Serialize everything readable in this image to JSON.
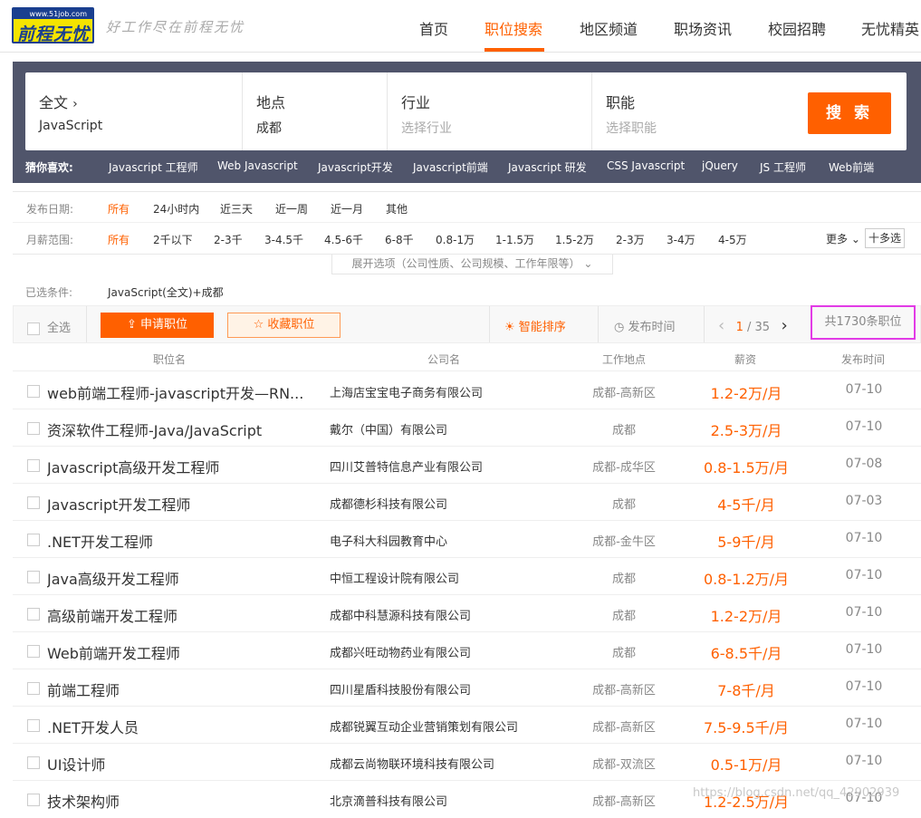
{
  "header": {
    "logo_url": "www.51job.com",
    "logo_name": "前程无忧",
    "slogan": "好工作尽在前程无忧",
    "nav": [
      {
        "label": "首页"
      },
      {
        "label": "职位搜索"
      },
      {
        "label": "地区频道"
      },
      {
        "label": "职场资讯"
      },
      {
        "label": "校园招聘"
      },
      {
        "label": "无忧精英"
      }
    ]
  },
  "search": {
    "fulltext_label": "全文",
    "fulltext_value": "JavaScript",
    "location_label": "地点",
    "location_value": "成都",
    "industry_label": "行业",
    "industry_placeholder": "选择行业",
    "function_label": "职能",
    "function_placeholder": "选择职能",
    "button": "搜 索",
    "guess_label": "猜你喜欢:",
    "guess": [
      "Javascript 工程师",
      "Web Javascript",
      "Javascript开发",
      "Javascript前端",
      "Javascript 研发",
      "CSS Javascript",
      "jQuery",
      "JS 工程师",
      "Web前端"
    ]
  },
  "filters": {
    "date_label": "发布日期:",
    "date_opts": [
      "所有",
      "24小时内",
      "近三天",
      "近一周",
      "近一月",
      "其他"
    ],
    "salary_label": "月薪范围:",
    "salary_opts": [
      "所有",
      "2千以下",
      "2-3千",
      "3-4.5千",
      "4.5-6千",
      "6-8千",
      "0.8-1万",
      "1-1.5万",
      "1.5-2万",
      "2-3万",
      "3-4万",
      "4-5万"
    ],
    "more": "更多",
    "multi": "十多选",
    "expand": "展开选项（公司性质、公司规模、工作年限等）"
  },
  "selected": {
    "label": "已选条件:",
    "value": "JavaScript(全文)+成都"
  },
  "toolbar": {
    "select_all": "全选",
    "apply": "申请职位",
    "favorite": "收藏职位",
    "smart_sort": "智能排序",
    "pub_time": "发布时间",
    "page_current": "1",
    "page_sep": " / 35",
    "total": "共1730条职位"
  },
  "table": {
    "headers": [
      "职位名",
      "公司名",
      "工作地点",
      "薪资",
      "发布时间"
    ],
    "rows": [
      {
        "title": "web前端工程师-javascript开发—RN...",
        "company": "上海店宝宝电子商务有限公司",
        "location": "成都-高新区",
        "salary": "1.2-2万/月",
        "date": "07-10"
      },
      {
        "title": "资深软件工程师-Java/JavaScript",
        "company": "戴尔（中国）有限公司",
        "location": "成都",
        "salary": "2.5-3万/月",
        "date": "07-10"
      },
      {
        "title": "Javascript高级开发工程师",
        "company": "四川艾普特信息产业有限公司",
        "location": "成都-成华区",
        "salary": "0.8-1.5万/月",
        "date": "07-08"
      },
      {
        "title": "Javascript开发工程师",
        "company": "成都德杉科技有限公司",
        "location": "成都",
        "salary": "4-5千/月",
        "date": "07-03"
      },
      {
        "title": ".NET开发工程师",
        "company": "电子科大科园教育中心",
        "location": "成都-金牛区",
        "salary": "5-9千/月",
        "date": "07-10"
      },
      {
        "title": "Java高级开发工程师",
        "company": "中恒工程设计院有限公司",
        "location": "成都",
        "salary": "0.8-1.2万/月",
        "date": "07-10"
      },
      {
        "title": "高级前端开发工程师",
        "company": "成都中科慧源科技有限公司",
        "location": "成都",
        "salary": "1.2-2万/月",
        "date": "07-10"
      },
      {
        "title": "Web前端开发工程师",
        "company": "成都兴旺动物药业有限公司",
        "location": "成都",
        "salary": "6-8.5千/月",
        "date": "07-10"
      },
      {
        "title": "前端工程师",
        "company": "四川星盾科技股份有限公司",
        "location": "成都-高新区",
        "salary": "7-8千/月",
        "date": "07-10"
      },
      {
        "title": ".NET开发人员",
        "company": "成都锐翼互动企业营销策划有限公司",
        "location": "成都-高新区",
        "salary": "7.5-9.5千/月",
        "date": "07-10"
      },
      {
        "title": "UI设计师",
        "company": "成都云尚物联环境科技有限公司",
        "location": "成都-双流区",
        "salary": "0.5-1万/月",
        "date": "07-10"
      },
      {
        "title": "技术架构师",
        "company": "北京滴普科技有限公司",
        "location": "成都-高新区",
        "salary": "1.2-2.5万/月",
        "date": "07-10"
      }
    ]
  },
  "watermark": "https://blog.csdn.net/qq_42902939"
}
